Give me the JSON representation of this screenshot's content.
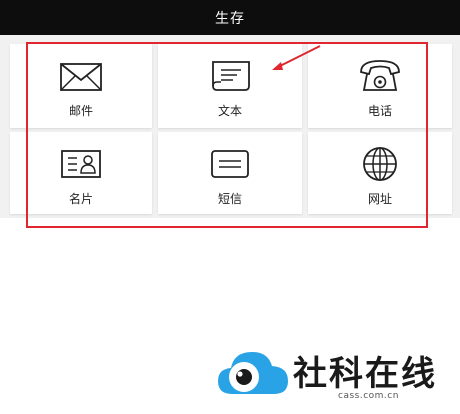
{
  "header": {
    "title": "生存"
  },
  "grid": {
    "items": [
      {
        "label": "邮件",
        "icon": "mail-icon"
      },
      {
        "label": "文本",
        "icon": "note-icon"
      },
      {
        "label": "电话",
        "icon": "phone-icon"
      },
      {
        "label": "名片",
        "icon": "contact-card-icon"
      },
      {
        "label": "短信",
        "icon": "message-icon"
      },
      {
        "label": "网址",
        "icon": "globe-icon"
      }
    ]
  },
  "watermark": {
    "name": "社科在线",
    "domain": "cass.com.cn"
  },
  "colors": {
    "header_bg": "#0d0d0d",
    "highlight": "#e0262e",
    "logo_blue": "#2aa3e6"
  }
}
